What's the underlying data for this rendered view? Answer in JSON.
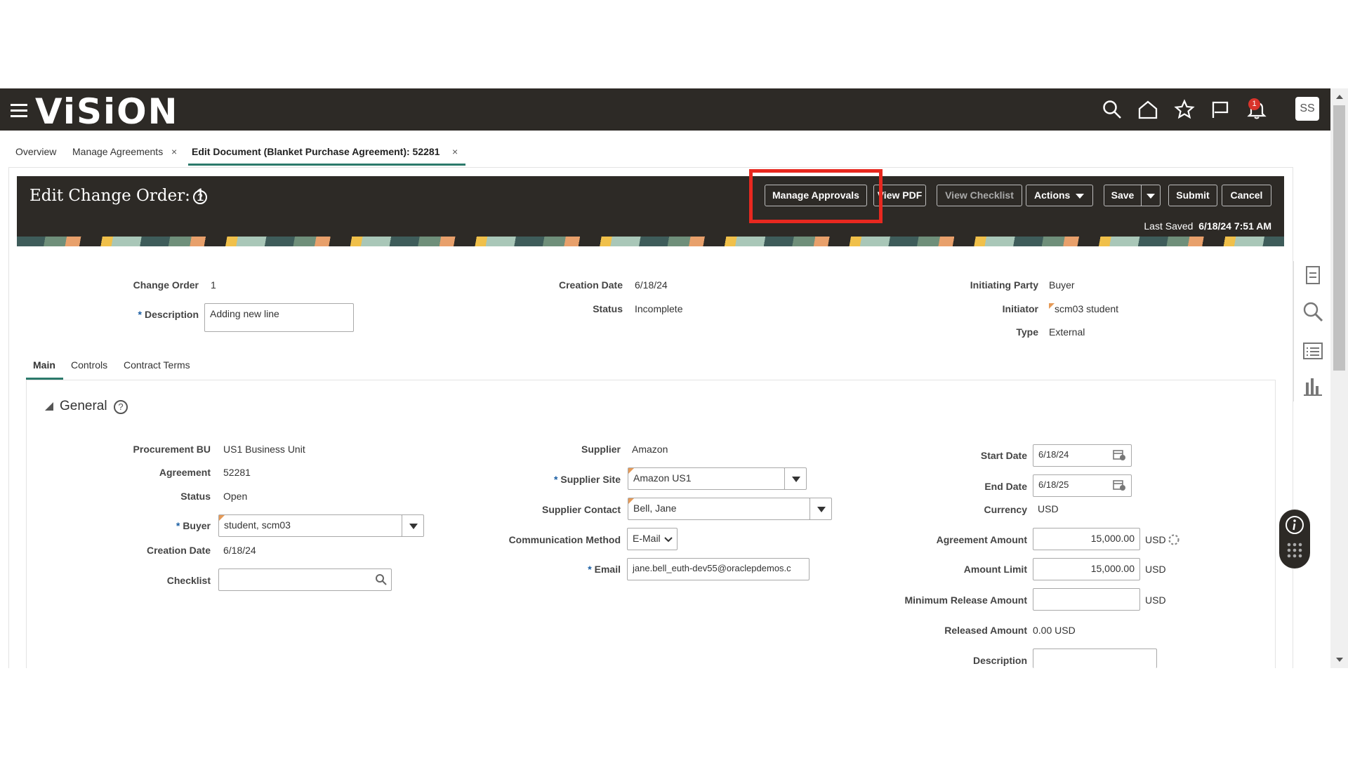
{
  "topbar": {
    "logo": "ViSiON",
    "notification_count": "1",
    "avatar_initials": "SS",
    "icons": [
      "hamburger-icon",
      "search-icon",
      "home-icon",
      "star-icon",
      "flag-icon",
      "bell-icon"
    ]
  },
  "tabs": [
    {
      "label": "Overview"
    },
    {
      "label": "Manage Agreements",
      "close": "×"
    },
    {
      "label": "Edit Document (Blanket Purchase Agreement): 52281",
      "close": "×"
    }
  ],
  "header": {
    "title": "Edit Change Order: 1",
    "help": "?",
    "buttons": {
      "manage_approvals": "Manage Approvals",
      "view_pdf": "View PDF",
      "view_checklist": "View Checklist",
      "actions": "Actions",
      "save": "Save",
      "submit": "Submit",
      "cancel": "Cancel"
    },
    "last_saved_label": "Last Saved",
    "last_saved_value": "6/18/24 7:51 AM"
  },
  "summary": {
    "change_order_label": "Change Order",
    "change_order_value": "1",
    "description_label": "Description",
    "description_value": "Adding new line",
    "creation_date_label": "Creation Date",
    "creation_date_value": "6/18/24",
    "status_label": "Status",
    "status_value": "Incomplete",
    "initiating_party_label": "Initiating Party",
    "initiating_party_value": "Buyer",
    "initiator_label": "Initiator",
    "initiator_value": "scm03 student",
    "type_label": "Type",
    "type_value": "External"
  },
  "content_tabs": [
    "Main",
    "Controls",
    "Contract Terms"
  ],
  "general": {
    "title": "General",
    "help": "?",
    "procurement_bu_label": "Procurement BU",
    "procurement_bu_value": "US1 Business Unit",
    "agreement_label": "Agreement",
    "agreement_value": "52281",
    "status_label": "Status",
    "status_value": "Open",
    "buyer_label": "Buyer",
    "buyer_value": "student, scm03",
    "creation_date_label": "Creation Date",
    "creation_date_value": "6/18/24",
    "checklist_label": "Checklist",
    "checklist_value": "",
    "supplier_label": "Supplier",
    "supplier_value": "Amazon",
    "supplier_site_label": "Supplier Site",
    "supplier_site_value": "Amazon US1",
    "supplier_contact_label": "Supplier Contact",
    "supplier_contact_value": "Bell, Jane",
    "communication_method_label": "Communication Method",
    "communication_method_value": "E-Mail",
    "email_label": "Email",
    "email_value": "jane.bell_euth-dev55@oraclepdemos.c",
    "start_date_label": "Start Date",
    "start_date_value": "6/18/24",
    "end_date_label": "End Date",
    "end_date_value": "6/18/25",
    "currency_label": "Currency",
    "currency_value": "USD",
    "agreement_amount_label": "Agreement Amount",
    "agreement_amount_value": "15,000.00",
    "agreement_amount_currency": "USD",
    "amount_limit_label": "Amount Limit",
    "amount_limit_value": "15,000.00",
    "amount_limit_currency": "USD",
    "min_release_label": "Minimum Release Amount",
    "min_release_value": "",
    "min_release_currency": "USD",
    "released_amount_label": "Released Amount",
    "released_amount_value": "0.00 USD",
    "description_label": "Description",
    "description_value": ""
  }
}
